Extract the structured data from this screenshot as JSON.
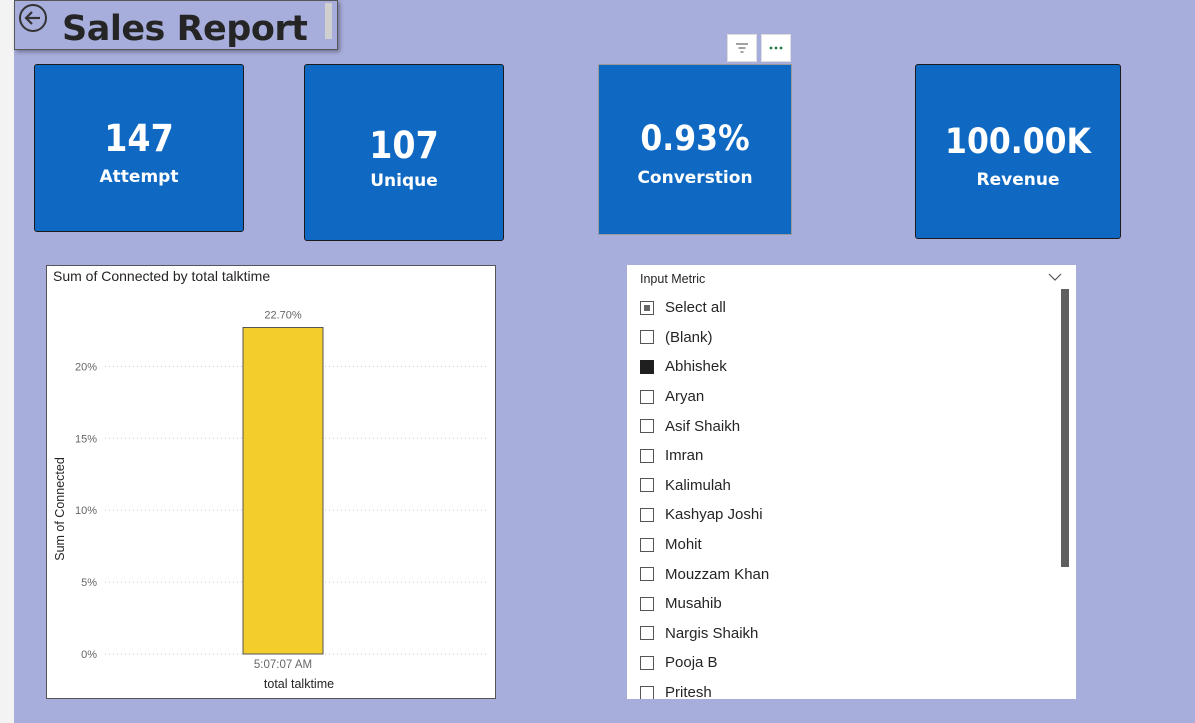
{
  "report": {
    "title": "Sales Report"
  },
  "cards": [
    {
      "value": "147",
      "label": "Attempt"
    },
    {
      "value": "107",
      "label": "Unique"
    },
    {
      "value": "0.93%",
      "label": "Converstion"
    },
    {
      "value": "100.00K",
      "label": "Revenue"
    }
  ],
  "visual_header": {
    "filter_icon": "filter-icon",
    "more_icon": "more-options-icon"
  },
  "chart": {
    "title": "Sum of Connected by total talktime",
    "ylabel": "Sum of Connected",
    "xlabel": "total talktime",
    "bar_color": "#f2cd2c"
  },
  "chart_data": {
    "type": "bar",
    "title": "Sum of Connected by total talktime",
    "xlabel": "total talktime",
    "ylabel": "Sum of Connected",
    "categories": [
      "5:07:07 AM"
    ],
    "values": [
      22.7
    ],
    "data_labels": [
      "22.70%"
    ],
    "y_ticks": [
      "0%",
      "5%",
      "10%",
      "15%",
      "20%"
    ],
    "y_tick_values": [
      0,
      5,
      10,
      15,
      20
    ],
    "ylim": [
      0,
      23.5
    ],
    "grid": true
  },
  "slicer": {
    "header": "Input Metric",
    "items": [
      {
        "label": "Select all",
        "state": "partial"
      },
      {
        "label": "(Blank)",
        "state": "unchecked"
      },
      {
        "label": "Abhishek",
        "state": "checked"
      },
      {
        "label": "Aryan",
        "state": "unchecked"
      },
      {
        "label": "Asif Shaikh",
        "state": "unchecked"
      },
      {
        "label": "Imran",
        "state": "unchecked"
      },
      {
        "label": "Kalimulah",
        "state": "unchecked"
      },
      {
        "label": "Kashyap Joshi",
        "state": "unchecked"
      },
      {
        "label": "Mohit",
        "state": "unchecked"
      },
      {
        "label": "Mouzzam Khan",
        "state": "unchecked"
      },
      {
        "label": "Musahib",
        "state": "unchecked"
      },
      {
        "label": "Nargis Shaikh",
        "state": "unchecked"
      },
      {
        "label": "Pooja B",
        "state": "unchecked"
      },
      {
        "label": "Pritesh",
        "state": "unchecked"
      }
    ]
  }
}
